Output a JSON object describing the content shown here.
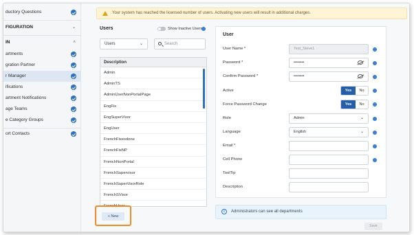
{
  "warning": {
    "text": "Your system has reached the licensed number of users. Activating new users will result in additional charges."
  },
  "sidebar": {
    "items_top": [
      {
        "label": "ductory Questions",
        "checked": true
      }
    ],
    "section_config": {
      "label": "FIGURATION",
      "chevron": "⌄"
    },
    "section_admin": {
      "label": "IN",
      "chevron": "˄"
    },
    "items": [
      {
        "label": "artments",
        "checked": true
      },
      {
        "label": "gration Partner",
        "checked": true
      },
      {
        "label": "r Manager",
        "checked": true,
        "active": true
      },
      {
        "label": "ifications",
        "checked": true
      },
      {
        "label": "artment Notifications",
        "checked": true
      },
      {
        "label": "age Teams",
        "checked": true
      },
      {
        "label": "e Category Groups",
        "checked": true
      }
    ],
    "items_bottom": [
      {
        "label": "ort Contacts",
        "checked": true
      }
    ]
  },
  "users": {
    "title": "Users",
    "toggle_label": "Show Inactive Users",
    "filter_value": "Users",
    "search_placeholder": "Search",
    "list_header": "Description",
    "rows": [
      "Admin",
      "AdminTS",
      "AdminUserNonPortalPage",
      "EngFix",
      "EngSuperVisor",
      "EngUser",
      "FrenchFixesdone",
      "FrenchFixNP",
      "FrenchNonPortal",
      "FrenchSupervisor",
      "FrenchSuperVisorRole",
      "FrenchSVisor",
      "FrenchUser"
    ],
    "new_button": "+ New"
  },
  "form": {
    "title": "User",
    "username_label": "User Name *",
    "username_value": "Test_Steve1",
    "password_label": "Password *",
    "password_value": "••••••••",
    "confirm_label": "Confirm Password *",
    "confirm_value": "••••••••",
    "active_label": "Active",
    "force_label": "Force Password Change",
    "yes": "Yes",
    "no": "No",
    "role_label": "Role",
    "role_value": "Admin",
    "language_label": "Language",
    "language_value": "English",
    "email_label": "Email *",
    "cell_label": "Cell Phone",
    "tooltip_label": "ToolTip",
    "description_label": "Description"
  },
  "admin_note": {
    "text": "Administrators can see all departments"
  },
  "save_button": "Save"
}
